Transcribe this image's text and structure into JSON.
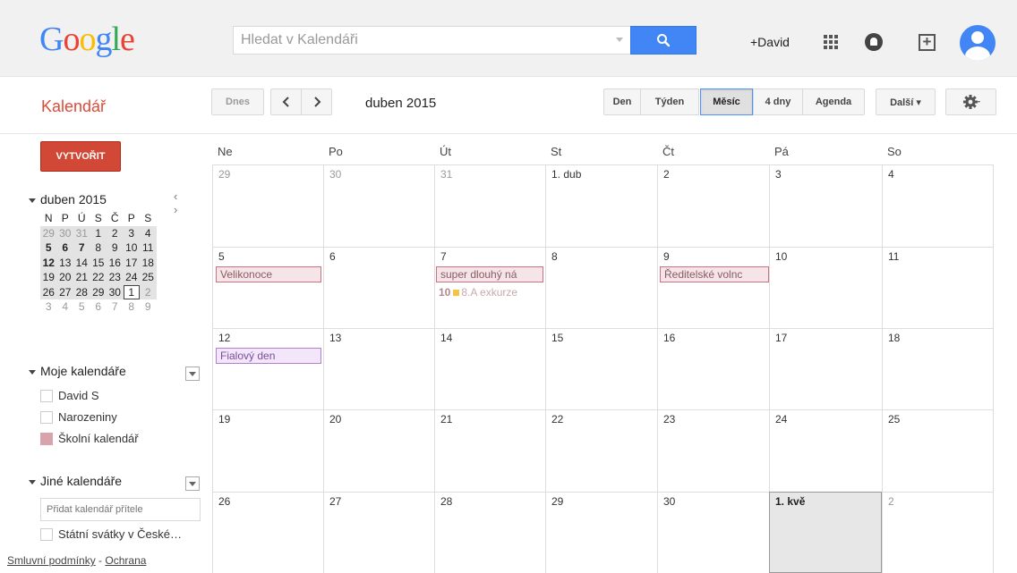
{
  "header": {
    "logo": "Google",
    "search_placeholder": "Hledat v Kalendáři",
    "user": "+David",
    "icons": [
      "search-icon",
      "apps-icon",
      "notifications-icon",
      "share-icon",
      "avatar"
    ]
  },
  "toolbar": {
    "app_name": "Kalendář",
    "today": "Dnes",
    "prev": "‹",
    "next": "›",
    "period": "duben 2015",
    "views": [
      "Den",
      "Týden",
      "Měsíc",
      "4 dny",
      "Agenda"
    ],
    "active_view": "Měsíc",
    "more": "Další ▾",
    "settings": "gear-icon"
  },
  "sidebar": {
    "create": "VYTVOŘIT",
    "mini": {
      "title": "duben 2015",
      "nav": "‹ ›",
      "weekdays": [
        "N",
        "P",
        "Ú",
        "S",
        "Č",
        "P",
        "S"
      ],
      "weeks": [
        [
          "29",
          "30",
          "31",
          "1",
          "2",
          "3",
          "4"
        ],
        [
          "5",
          "6",
          "7",
          "8",
          "9",
          "10",
          "11"
        ],
        [
          "12",
          "13",
          "14",
          "15",
          "16",
          "17",
          "18"
        ],
        [
          "19",
          "20",
          "21",
          "22",
          "23",
          "24",
          "25"
        ],
        [
          "26",
          "27",
          "28",
          "29",
          "30",
          "1",
          "2"
        ],
        [
          "3",
          "4",
          "5",
          "6",
          "7",
          "8",
          "9"
        ]
      ]
    },
    "my_calendars_title": "Moje kalendáře",
    "my_calendars": [
      {
        "label": "David S",
        "color": "#ffffff"
      },
      {
        "label": "Narozeniny",
        "color": "#ffffff"
      },
      {
        "label": "Školní kalendář",
        "color": "#d9a3ab"
      }
    ],
    "other_calendars_title": "Jiné kalendáře",
    "add_friend_placeholder": "Přidat kalendář přítele",
    "other_calendars": [
      {
        "label": "Státní svátky v České…",
        "color": "#ffffff"
      }
    ],
    "footer_terms": "Smluvní podmínky",
    "footer_sep": " - ",
    "footer_privacy": "Ochrana"
  },
  "month": {
    "weekdays": [
      "Ne",
      "Po",
      "Út",
      "St",
      "Čt",
      "Pá",
      "So"
    ],
    "weeks": [
      [
        "29",
        "30",
        "31",
        "1. dub",
        "2",
        "3",
        "4"
      ],
      [
        "5",
        "6",
        "7",
        "8",
        "9",
        "10",
        "11"
      ],
      [
        "12",
        "13",
        "14",
        "15",
        "16",
        "17",
        "18"
      ],
      [
        "19",
        "20",
        "21",
        "22",
        "23",
        "24",
        "25"
      ],
      [
        "26",
        "27",
        "28",
        "29",
        "30",
        "1. kvě",
        "2"
      ]
    ],
    "events": {
      "velikonoce": "Velikonoce",
      "dlouhy": "super dlouhý ná",
      "exkurze_time": "10",
      "exkurze": "8.A exkurze",
      "reditelske": "Ředitelské volnc",
      "fialovy": "Fialový den"
    },
    "colors": {
      "event_bg": "#f6e5e8",
      "event_border": "#c9737f",
      "purple_bg": "#f3e6fb",
      "exkurze_square": "#f6c343"
    }
  }
}
